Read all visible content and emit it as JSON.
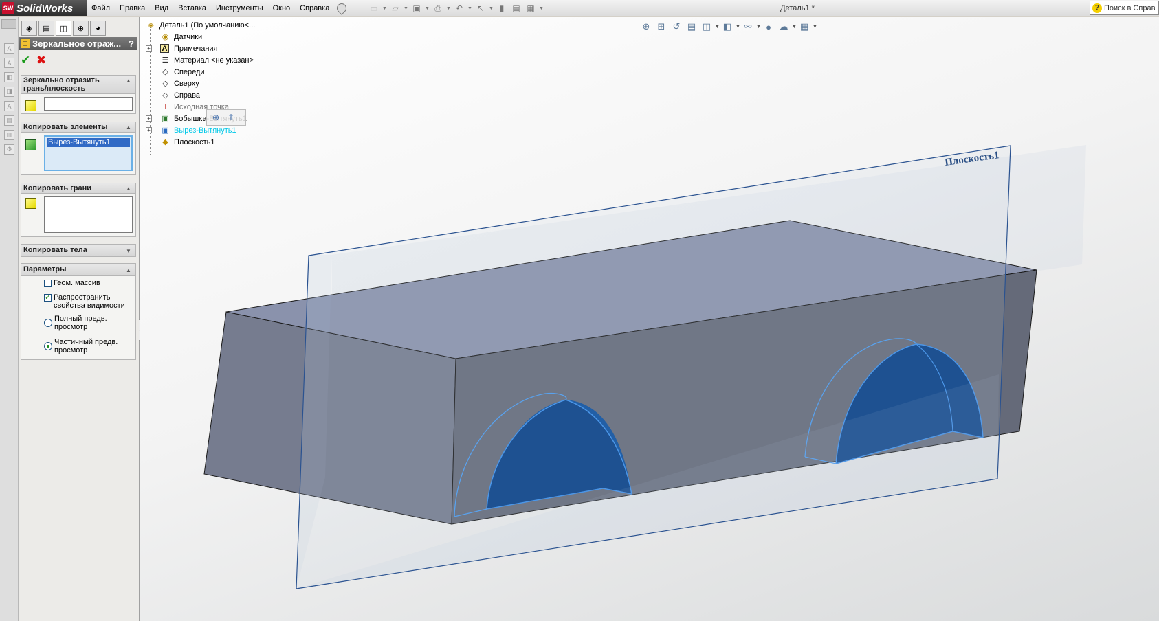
{
  "app": {
    "brand": "SolidWorks",
    "brand_mark": "SW",
    "document_title": "Деталь1 *",
    "help_search_placeholder": "Поиск в Справ"
  },
  "menu": {
    "items": [
      "Файл",
      "Правка",
      "Вид",
      "Вставка",
      "Инструменты",
      "Окно",
      "Справка"
    ]
  },
  "property_manager": {
    "title": "Зеркальное отраж...",
    "help": "?",
    "ok": "✔",
    "cancel": "✖",
    "mirror_face": {
      "header": "Зеркально отразить грань/плоскость",
      "value": ""
    },
    "copy_features": {
      "header": "Копировать элементы",
      "items": [
        "Вырез-Вытянуть1"
      ]
    },
    "copy_faces": {
      "header": "Копировать грани",
      "value": ""
    },
    "copy_bodies": {
      "header": "Копировать тела"
    },
    "options": {
      "header": "Параметры",
      "geometry_pattern": "Геом. массив",
      "geometry_pattern_checked": false,
      "propagate_visual": "Распространить свойства видимости",
      "propagate_visual_checked": true,
      "full_preview": "Полный предв. просмотр",
      "partial_preview": "Частичный предв. просмотр",
      "selected_preview": "partial"
    }
  },
  "feature_tree": {
    "root": "Деталь1 (По умолчанию<...",
    "items": [
      {
        "label": "Датчики",
        "icon": "sensor-icon",
        "expandable": false
      },
      {
        "label": "Примечания",
        "icon": "annotations-icon",
        "expandable": true
      },
      {
        "label": "Материал <не указан>",
        "icon": "material-icon",
        "expandable": false
      },
      {
        "label": "Спереди",
        "icon": "plane-icon",
        "expandable": false
      },
      {
        "label": "Сверху",
        "icon": "plane-icon",
        "expandable": false
      },
      {
        "label": "Справа",
        "icon": "plane-icon",
        "expandable": false
      },
      {
        "label": "Исходная точка",
        "icon": "origin-icon",
        "expandable": false
      },
      {
        "label": "Бобышка-Вытянуть1",
        "icon": "extrude-boss-icon",
        "expandable": true
      },
      {
        "label": "Вырез-Вытянуть1",
        "icon": "extrude-cut-icon",
        "expandable": true,
        "highlighted": true
      },
      {
        "label": "Плоскость1",
        "icon": "plane-selected-icon",
        "expandable": false
      }
    ]
  },
  "viewport": {
    "plane_label": "Плоскость1",
    "colors": {
      "body_top": "#8a93ad",
      "body_side": "#666b7a",
      "body_front": "#737a8e",
      "cut_face": "#0a4ea0",
      "edge_highlight": "#3a8eea",
      "plane_border": "#2a5290"
    }
  }
}
